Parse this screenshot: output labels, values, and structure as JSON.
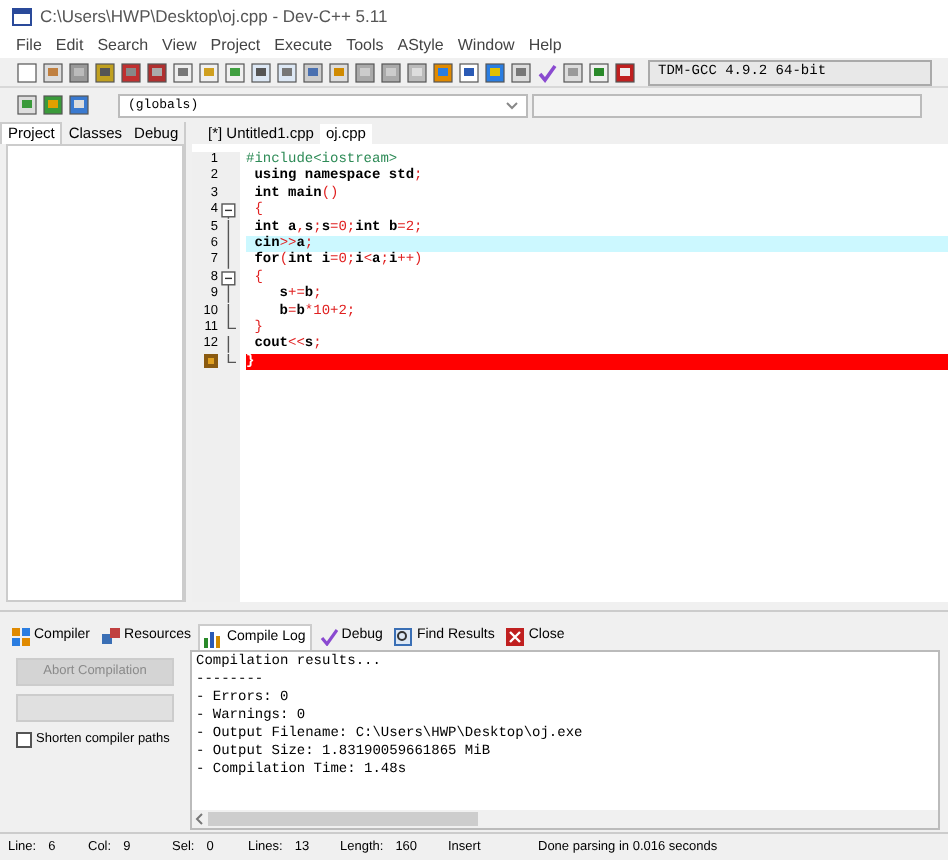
{
  "window": {
    "title": "C:\\Users\\HWP\\Desktop\\oj.cpp - Dev-C++ 5.11"
  },
  "menu": [
    "File",
    "Edit",
    "Search",
    "View",
    "Project",
    "Execute",
    "Tools",
    "AStyle",
    "Window",
    "Help"
  ],
  "toolbar": {
    "compiler": "TDM-GCC 4.9.2 64-bit"
  },
  "toolbar2": {
    "scope": "(globals)"
  },
  "side_tabs": [
    {
      "label": "Project",
      "selected": true
    },
    {
      "label": "Classes",
      "selected": false
    },
    {
      "label": "Debug",
      "selected": false
    }
  ],
  "file_tabs": [
    {
      "label": "[*] Untitled1.cpp",
      "selected": false
    },
    {
      "label": "oj.cpp",
      "selected": true
    }
  ],
  "editor": {
    "lines": [
      {
        "number": "1",
        "text": "#include<iostream>",
        "kind": "preprocessor",
        "fold_start": false,
        "fold_end": false,
        "current": false,
        "error": false
      },
      {
        "number": "2",
        "text": " using namespace std;",
        "kind": "code",
        "fold_start": false,
        "fold_end": false,
        "current": false,
        "error": false
      },
      {
        "number": "3",
        "text": " int main()",
        "kind": "code",
        "fold_start": false,
        "fold_end": false,
        "current": false,
        "error": false
      },
      {
        "number": "4",
        "text": " {",
        "kind": "code",
        "fold_start": true,
        "fold_end": false,
        "current": false,
        "error": false
      },
      {
        "number": "5",
        "text": " int a,s;s=0;int b=2;",
        "kind": "code",
        "fold_start": false,
        "fold_end": false,
        "current": false,
        "error": false
      },
      {
        "number": "6",
        "text": " cin>>a;",
        "kind": "code",
        "fold_start": false,
        "fold_end": false,
        "current": true,
        "error": false
      },
      {
        "number": "7",
        "text": " for(int i=0;i<a;i++)",
        "kind": "code",
        "fold_start": false,
        "fold_end": false,
        "current": false,
        "error": false
      },
      {
        "number": "8",
        "text": " {",
        "kind": "code",
        "fold_start": true,
        "fold_end": false,
        "current": false,
        "error": false
      },
      {
        "number": "9",
        "text": "    s+=b;",
        "kind": "code",
        "fold_start": false,
        "fold_end": false,
        "current": false,
        "error": false
      },
      {
        "number": "10",
        "text": "    b=b*10+2;",
        "kind": "code",
        "fold_start": false,
        "fold_end": false,
        "current": false,
        "error": false
      },
      {
        "number": "11",
        "text": " }",
        "kind": "code",
        "fold_start": false,
        "fold_end": true,
        "current": false,
        "error": false
      },
      {
        "number": "12",
        "text": " cout<<s;",
        "kind": "code",
        "fold_start": false,
        "fold_end": false,
        "current": false,
        "error": false
      },
      {
        "text": "}",
        "kind": "code",
        "fold_start": false,
        "fold_end": true,
        "current": false,
        "error": true
      }
    ]
  },
  "bottom_tabs": [
    {
      "label": "Compiler",
      "selected": false
    },
    {
      "label": "Resources",
      "selected": false
    },
    {
      "label": "Compile Log",
      "selected": true
    },
    {
      "label": "Debug",
      "selected": false
    },
    {
      "label": "Find Results",
      "selected": false
    },
    {
      "label": "Close",
      "selected": false
    }
  ],
  "compile_panel": {
    "abort_button": {
      "label": "Abort Compilation",
      "disabled": true
    },
    "progress": {
      "level": 0
    },
    "shorten_paths": {
      "label": "Shorten compiler paths",
      "checked": false
    }
  },
  "log": [
    "Compilation results...",
    "--------",
    "- Errors: 0",
    "- Warnings: 0",
    "- Output Filename: C:\\Users\\HWP\\Desktop\\oj.exe",
    "- Output Size: 1.83190059661865 MiB",
    "- Compilation Time: 1.48s"
  ],
  "status_bar": [
    {
      "label": "Line:",
      "value": "6"
    },
    {
      "label": "Col:",
      "value": "9"
    },
    {
      "label": "Sel:",
      "value": "0"
    },
    {
      "label": "Lines:",
      "value": "13"
    },
    {
      "label": "Length:",
      "value": "160"
    },
    {
      "value": "Insert"
    },
    {
      "value": "Done parsing in 0.016 seconds"
    }
  ]
}
